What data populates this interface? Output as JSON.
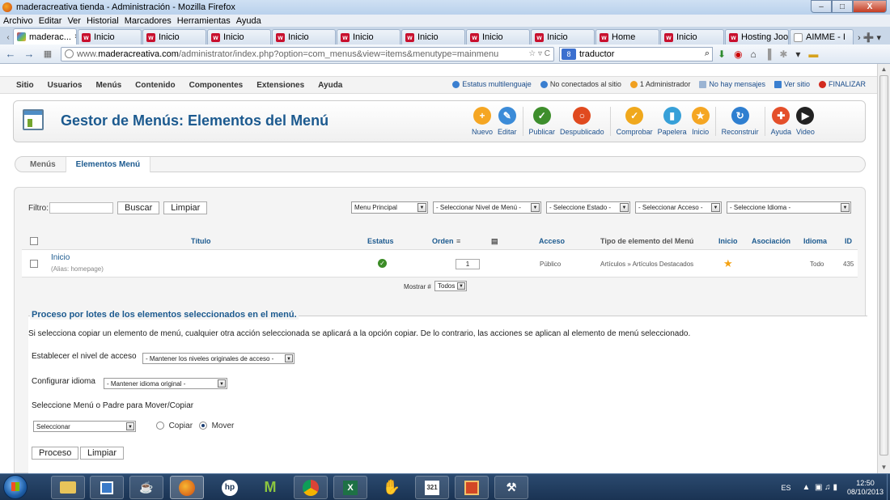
{
  "window": {
    "title": "maderacreativa tienda - Administración - Mozilla Firefox",
    "min": "–",
    "max": "□",
    "close": "X"
  },
  "browser_menu": [
    "Archivo",
    "Editar",
    "Ver",
    "Historial",
    "Marcadores",
    "Herramientas",
    "Ayuda"
  ],
  "tabs": [
    {
      "label": "maderac...",
      "icon": "joomla"
    },
    {
      "label": "Inicio",
      "icon": "w"
    },
    {
      "label": "Inicio",
      "icon": "w"
    },
    {
      "label": "Inicio",
      "icon": "w"
    },
    {
      "label": "Inicio",
      "icon": "w"
    },
    {
      "label": "Inicio",
      "icon": "w"
    },
    {
      "label": "Inicio",
      "icon": "w"
    },
    {
      "label": "Inicio",
      "icon": "w"
    },
    {
      "label": "Inicio",
      "icon": "w"
    },
    {
      "label": "Home",
      "icon": "w"
    },
    {
      "label": "Inicio",
      "icon": "w"
    },
    {
      "label": "Hosting Joo...",
      "icon": "w"
    },
    {
      "label": "AIMME - I",
      "icon": "blank"
    }
  ],
  "tab_close": "×",
  "navbar": {
    "url_prefix": "www.",
    "url_domain": "maderacreativa.com",
    "url_path": "/administrator/index.php?option=com_menus&view=items&menutype=mainmenu",
    "url_tail": "☆ ▿ C",
    "search_engine": "8",
    "search_value": "traductor"
  },
  "admin_menu": [
    "Sitio",
    "Usuarios",
    "Menús",
    "Contenido",
    "Componentes",
    "Extensiones",
    "Ayuda"
  ],
  "admin_status": {
    "multilang": "Estatus multilenguaje",
    "visitors": "No conectados al sitio",
    "admins": "1 Administrador",
    "messages": "No hay mensajes",
    "view_site": "Ver sitio",
    "logout": "FINALIZAR"
  },
  "page_title": "Gestor de Menús: Elementos del Menú",
  "toolbar": [
    {
      "label": "Nuevo",
      "color": "#f5a623",
      "glyph": "+"
    },
    {
      "label": "Editar",
      "color": "#3b8bd8",
      "glyph": "✎"
    },
    {
      "label": "Publicar",
      "color": "#3e8e2c",
      "glyph": "✓"
    },
    {
      "label": "Despublicado",
      "color": "#e04a1f",
      "glyph": "○"
    },
    {
      "label": "Comprobar",
      "color": "#f0a81c",
      "glyph": "✓"
    },
    {
      "label": "Papelera",
      "color": "#37a0d8",
      "glyph": "▮"
    },
    {
      "label": "Inicio",
      "color": "#f5a623",
      "glyph": "★"
    },
    {
      "label": "Reconstruir",
      "color": "#2f7fd0",
      "glyph": "↻"
    },
    {
      "label": "Ayuda",
      "color": "#e44f2a",
      "glyph": "✚"
    },
    {
      "label": "Video",
      "color": "#222222",
      "glyph": "▶"
    }
  ],
  "subnav": {
    "menus": "Menús",
    "items": "Elementos Menú"
  },
  "filter": {
    "label": "Filtro:",
    "value": "",
    "search_btn": "Buscar",
    "clear_btn": "Limpiar"
  },
  "filter_selects": [
    {
      "label": "Menu Principal",
      "key": "menu"
    },
    {
      "label": "- Seleccionar Nivel de Menú -",
      "key": "level"
    },
    {
      "label": "- Seleccione Estado -",
      "key": "state"
    },
    {
      "label": "- Seleccionar Acceso -",
      "key": "access"
    },
    {
      "label": "- Seleccione Idioma -",
      "key": "language"
    }
  ],
  "table": {
    "headers": {
      "title": "Título",
      "status": "Estatus",
      "order": "Orden",
      "access": "Acceso",
      "type": "Tipo de elemento del Menú",
      "home": "Inicio",
      "association": "Asociación",
      "language": "Idioma",
      "id": "ID"
    },
    "rows": [
      {
        "title": "Inicio",
        "alias": "(Alias: homepage)",
        "status": "published",
        "order": "1",
        "access": "Público",
        "type": "Artículos » Artículos Destacados",
        "home": "star",
        "association": "",
        "language": "Todo",
        "id": "435"
      }
    ],
    "show_label": "Mostrar #",
    "show_value": "Todos"
  },
  "batch": {
    "legend": "Proceso por lotes de los elementos seleccionados en el menú.",
    "description": "Si selecciona copiar un elemento de menú, cualquier otra acción seleccionada se aplicará a la opción copiar. De lo contrario, las acciones se aplican al elemento de menú seleccionado.",
    "access_label": "Establecer el nivel de acceso",
    "access_value": "- Mantener los niveles originales de acceso -",
    "lang_label": "Configurar idioma",
    "lang_value": "- Mantener idioma original -",
    "move_label": "Seleccione Menú o Padre para Mover/Copiar",
    "move_value": "Seleccionar",
    "copy_label": "Copiar",
    "move_option": "Mover",
    "selected_option": "move",
    "process_btn": "Proceso",
    "clear_btn": "Limpiar"
  },
  "taskbar": {
    "apps": [
      "explorer",
      "media-center",
      "network",
      "firefox",
      "hp",
      "movistar",
      "chrome",
      "excel",
      "tux",
      "calendar",
      "powerpoint",
      "tools"
    ],
    "calendar_day": "321",
    "language": "ES",
    "time": "12:50",
    "date": "08/10/2013"
  }
}
